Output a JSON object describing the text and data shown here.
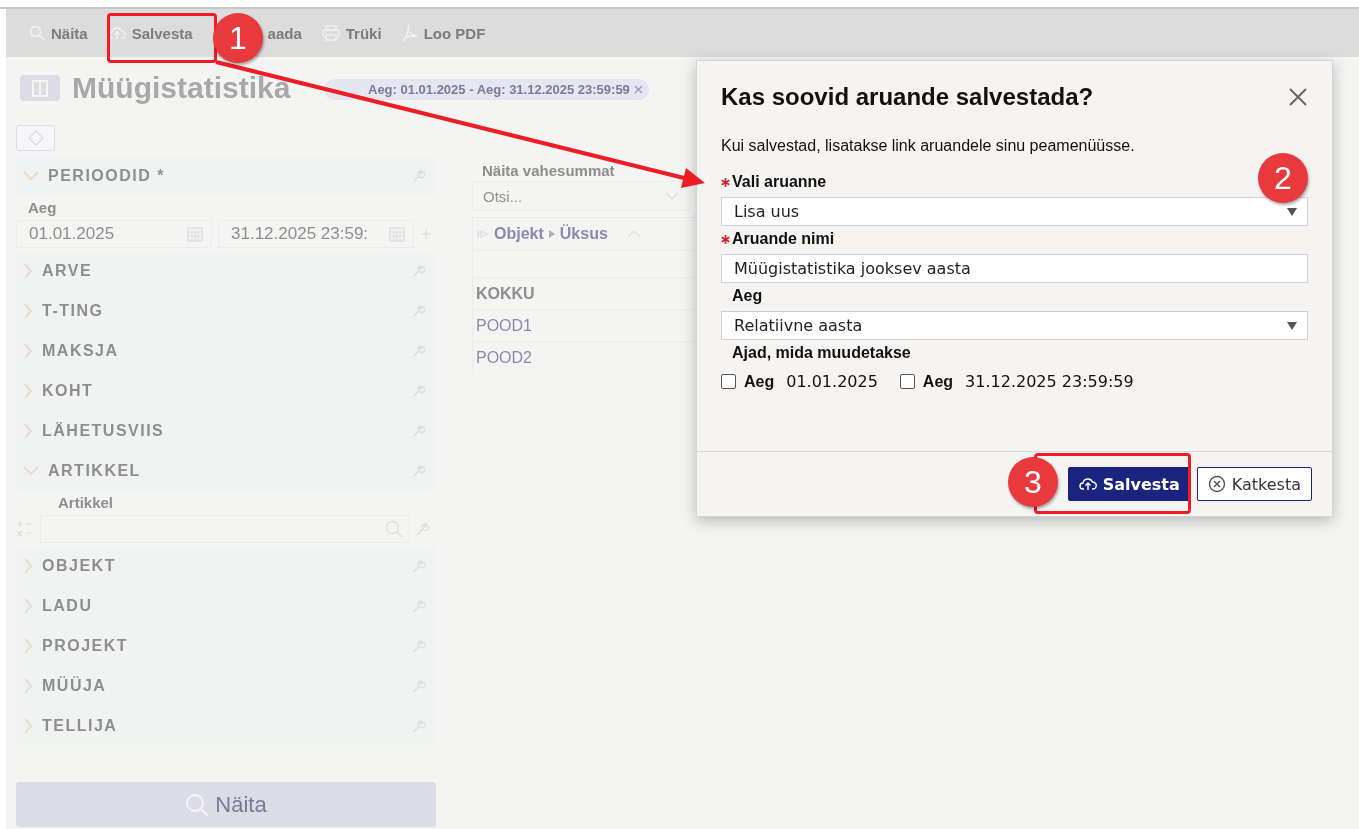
{
  "toolbar": [
    {
      "label": "Näita"
    },
    {
      "label": "Salvesta"
    },
    {
      "label": "aada"
    },
    {
      "label": "Trüki"
    },
    {
      "label": "Loo PDF"
    }
  ],
  "page_title": "Müügistatistika",
  "filter_chip": "Aeg: 01.01.2025 - Aeg: 31.12.2025 23:59:59",
  "sidebar": {
    "sections": [
      {
        "title": "PERIOODID *",
        "expanded": true,
        "kind": "dates",
        "label": "Aeg",
        "values": [
          "01.01.2025",
          "31.12.2025 23:59:"
        ]
      },
      {
        "title": "ARVE",
        "expanded": false
      },
      {
        "title": "T-TING",
        "expanded": false
      },
      {
        "title": "MAKSJA",
        "expanded": false
      },
      {
        "title": "KOHT",
        "expanded": false
      },
      {
        "title": "LÄHETUSVIIS",
        "expanded": false
      },
      {
        "title": "ARTIKKEL",
        "expanded": true,
        "kind": "search",
        "label": "Artikkel"
      },
      {
        "title": "OBJEKT",
        "expanded": false
      },
      {
        "title": "LADU",
        "expanded": false
      },
      {
        "title": "PROJEKT",
        "expanded": false
      },
      {
        "title": "MÜÜJA",
        "expanded": false
      },
      {
        "title": "TELLIJA",
        "expanded": false
      }
    ],
    "show_button": "Näita"
  },
  "content": {
    "subtotal_label": "Näita vahesummat",
    "subtotal_placeholder": "Otsi...",
    "pivot_header": [
      "Objekt",
      "Üksus"
    ],
    "rows": [
      {
        "label": "KOKKU",
        "kind": "total"
      },
      {
        "label": "POOD1",
        "kind": "link"
      },
      {
        "label": "POOD2",
        "kind": "link"
      }
    ]
  },
  "dialog": {
    "title": "Kas soovid aruande salvestada?",
    "description": "Kui salvestad, lisatakse link aruandele sinu peamenüüsse.",
    "fields": [
      {
        "label": "Vali aruanne",
        "required": true,
        "kind": "select",
        "value": "Lisa uus"
      },
      {
        "label": "Aruande nimi",
        "required": true,
        "kind": "input",
        "value": "Müügistatistika jooksev aasta"
      },
      {
        "label": "Aeg",
        "required": false,
        "kind": "select",
        "value": "Relatiivne aasta"
      }
    ],
    "times_label": "Ajad, mida muudetakse",
    "checkboxes": [
      {
        "label": "Aeg",
        "value": "01.01.2025",
        "checked": false
      },
      {
        "label": "Aeg",
        "value": "31.12.2025 23:59:59",
        "checked": false
      }
    ],
    "buttons": [
      {
        "label": "Salvesta",
        "kind": "primary"
      },
      {
        "label": "Katkesta",
        "kind": "secondary"
      }
    ]
  },
  "callouts": [
    "1",
    "2",
    "3"
  ]
}
